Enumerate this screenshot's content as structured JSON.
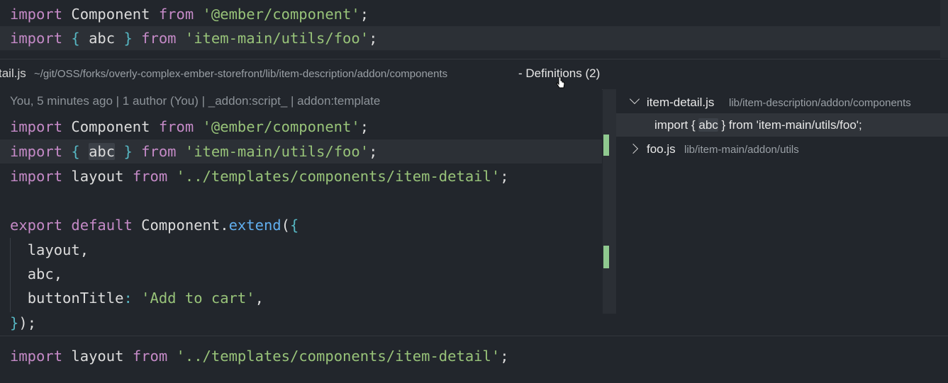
{
  "top_editor": {
    "line1": {
      "kw1": "import",
      "name": " Component ",
      "kw2": "from",
      "space": " ",
      "str": "'@ember/component'",
      "end": ";"
    },
    "line2": {
      "kw1": "import",
      "sp1": " ",
      "open": "{",
      "sp2": " ",
      "word": "abc",
      "sp3": " ",
      "close": "}",
      "sp4": " ",
      "kw2": "from",
      "sp5": " ",
      "str": "'item-main/utils/foo'",
      "end": ";"
    }
  },
  "peek_header": {
    "file_name": "tail.js",
    "path": "~/git/OSS/forks/overly-complex-ember-storefront/lib/item-description/addon/components",
    "definitions": "- Definitions (2)"
  },
  "peek_editor": {
    "codelens": "You, 5 minutes ago | 1 author (You) | _addon:script_ | addon:template",
    "lines": [
      {
        "kw1": "import",
        "name": " Component ",
        "kw2": "from",
        "space": " ",
        "str": "'@ember/component'",
        "end": ";"
      },
      {
        "kw1": "import",
        "sp1": " ",
        "open": "{",
        "sp2": " ",
        "word": "abc",
        "sp3": " ",
        "close": "}",
        "sp4": " ",
        "kw2": "from",
        "sp5": " ",
        "str": "'item-main/utils/foo'",
        "end": ";"
      },
      {
        "kw1": "import",
        "name": " layout ",
        "kw2": "from",
        "space": " ",
        "str": "'../templates/components/item-detail'",
        "end": ";"
      },
      {
        "kw1": "export",
        "sp1": " ",
        "kw2": "default",
        "name": " Component",
        "dot": ".",
        "fn": "extend",
        "open": "(",
        "brace": "{"
      },
      {
        "indent": "  ",
        "text": "layout",
        "comma": ","
      },
      {
        "indent": "  ",
        "text": "abc",
        "comma": ","
      },
      {
        "indent": "  ",
        "key": "buttonTitle",
        "colon": ":",
        "sp": " ",
        "str": "'Add to cart'",
        "comma": ","
      },
      {
        "brace": "}",
        "paren": ")",
        "end": ";"
      }
    ]
  },
  "results": {
    "group1": {
      "file": "item-detail.js",
      "path": "lib/item-description/addon/components"
    },
    "match1": {
      "before": "import { ",
      "word": "abc",
      "after": " } from 'item-main/utils/foo';"
    },
    "group2": {
      "file": "foo.js",
      "path": "lib/item-main/addon/utils"
    }
  },
  "bottom_editor": {
    "line": {
      "kw1": "import",
      "name": " layout ",
      "kw2": "from",
      "space": " ",
      "str": "'../templates/components/item-detail'",
      "end": ";"
    }
  },
  "colors": {
    "keyword": "#c58ac7",
    "string": "#98c379",
    "bracket": "#56b6c2",
    "function": "#61afef",
    "gutter_added": "#8fc98f",
    "background": "#22262c"
  }
}
